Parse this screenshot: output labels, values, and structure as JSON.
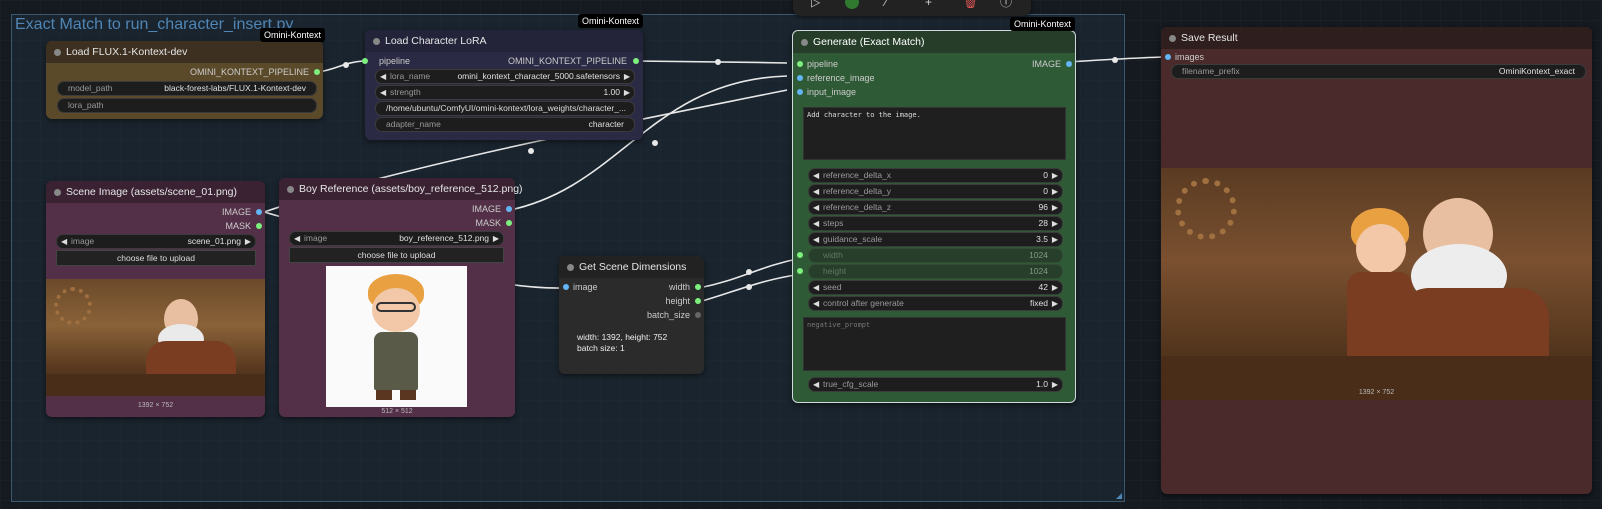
{
  "group": {
    "title": "Exact Match to run_character_insert.py"
  },
  "toolbar": {
    "icons": [
      "play-icon",
      "status-dot-icon",
      "edit-icon",
      "plus-icon",
      "delete-icon",
      "info-icon"
    ]
  },
  "nodes": {
    "load_flux": {
      "title": "Load FLUX.1-Kontext-dev",
      "badge": "Omini-Kontext",
      "output": "OMINI_KONTEXT_PIPELINE",
      "widgets": [
        {
          "label": "model_path",
          "value": "black-forest-labs/FLUX.1-Kontext-dev"
        },
        {
          "label": "lora_path",
          "value": ""
        }
      ]
    },
    "load_lora": {
      "title": "Load Character LoRA",
      "badge": "Omini-Kontext",
      "input": "pipeline",
      "output": "OMINI_KONTEXT_PIPELINE",
      "lora_name_label": "lora_name",
      "lora_name": "omini_kontext_character_5000.safetensors",
      "strength_label": "strength",
      "strength": "1.00",
      "path": "/home/ubuntu/ComfyUI/omini-kontext/lora_weights/character_...",
      "adapter_label": "adapter_name",
      "adapter_name": "character"
    },
    "scene_image": {
      "title": "Scene Image (assets/scene_01.png)",
      "out_image": "IMAGE",
      "out_mask": "MASK",
      "image_label": "image",
      "image_value": "scene_01.png",
      "upload": "choose file to upload",
      "caption": "1392 × 752"
    },
    "boy_ref": {
      "title": "Boy Reference (assets/boy_reference_512.png)",
      "out_image": "IMAGE",
      "out_mask": "MASK",
      "image_label": "image",
      "image_value": "boy_reference_512.png",
      "upload": "choose file to upload",
      "caption": "512 × 512"
    },
    "scene_dims": {
      "title": "Get Scene Dimensions",
      "input": "image",
      "outputs": [
        "width",
        "height",
        "batch_size"
      ],
      "info_line1": "width: 1392, height: 752",
      "info_line2": "batch size: 1"
    },
    "generate": {
      "title": "Generate (Exact Match)",
      "badge": "Omini-Kontext",
      "inputs": [
        "pipeline",
        "reference_image",
        "input_image"
      ],
      "output": "IMAGE",
      "prompt": "Add character to the image.",
      "widgets": [
        {
          "label": "reference_delta_x",
          "value": "0"
        },
        {
          "label": "reference_delta_y",
          "value": "0"
        },
        {
          "label": "reference_delta_z",
          "value": "96"
        },
        {
          "label": "steps",
          "value": "28"
        },
        {
          "label": "guidance_scale",
          "value": "3.5"
        },
        {
          "label": "width",
          "value": "1024"
        },
        {
          "label": "height",
          "value": "1024"
        },
        {
          "label": "seed",
          "value": "42"
        },
        {
          "label": "control after generate",
          "value": "fixed"
        }
      ],
      "negative_placeholder": "negative_prompt",
      "cfg_label": "true_cfg_scale",
      "cfg_value": "1.0"
    },
    "save_result": {
      "title": "Save Result",
      "input": "images",
      "prefix_label": "filename_prefix",
      "prefix_value": "OminiKontext_exact",
      "caption": "1392 × 752"
    }
  },
  "colors": {
    "pipeline_slot": "#7ef07e",
    "image_slot": "#64b5f6",
    "int_slot": "#7ef07e",
    "flux_body": "#5b4a2a",
    "lora_body": "#2a2a44",
    "image_body": "#533048",
    "generate_body": "#2f5a36",
    "save_body": "#4a2a2a"
  }
}
